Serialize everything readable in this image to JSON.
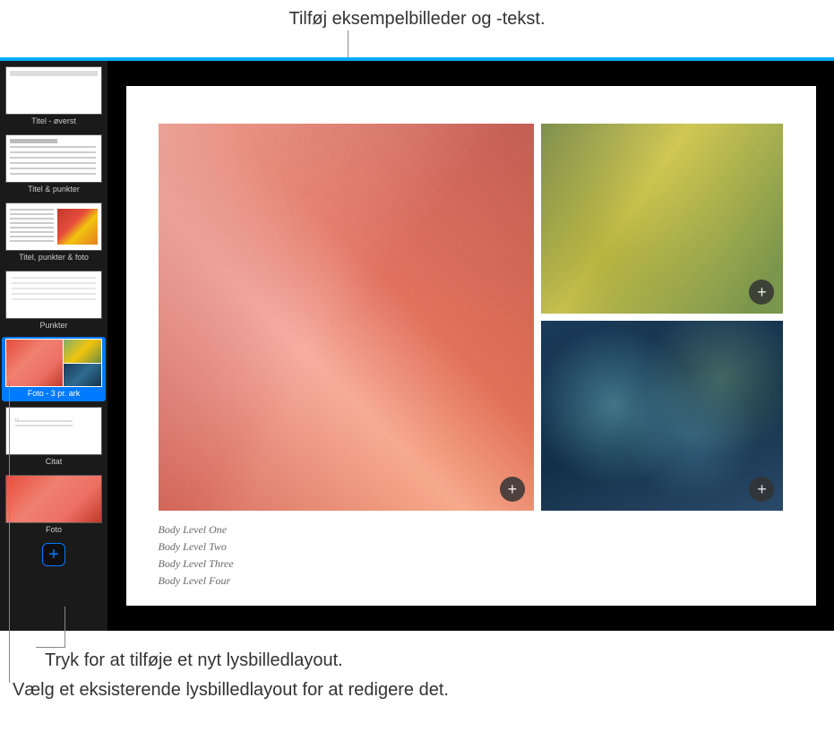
{
  "callouts": {
    "top": "Tilføj eksempelbilleder og -tekst.",
    "add_layout": "Tryk for at tilføje et nyt lysbilledlayout.",
    "select_layout": "Vælg et eksisterende lysbilledlayout for at redigere det."
  },
  "sidebar": {
    "items": [
      {
        "label": "Titel - øverst"
      },
      {
        "label": "Titel & punkter"
      },
      {
        "label": "Titel, punkter & foto"
      },
      {
        "label": "Punkter"
      },
      {
        "label": "Foto - 3 pr. ark"
      },
      {
        "label": "Citat"
      },
      {
        "label": "Foto"
      }
    ]
  },
  "slide": {
    "body_levels": [
      "Body Level One",
      "Body Level Two",
      "Body Level Three",
      "Body Level Four"
    ]
  }
}
